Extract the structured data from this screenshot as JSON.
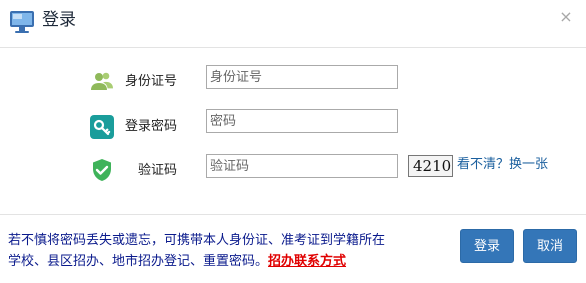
{
  "dialog": {
    "title": "登录",
    "close_glyph": "×",
    "icon": "monitor-icon"
  },
  "form": {
    "id_number": {
      "label": "身份证号",
      "placeholder": "身份证号",
      "value": "",
      "icon": "users-icon"
    },
    "password": {
      "label": "登录密码",
      "placeholder": "密码",
      "value": "",
      "icon": "key-icon"
    },
    "captcha": {
      "label": "验证码",
      "placeholder": "验证码",
      "value": "",
      "icon": "shield-check-icon",
      "image_text": "4210",
      "refresh_label": "看不清？换一张"
    }
  },
  "notice": {
    "line1": "若不慎将密码丢失或遗忘，可携带本人身份证、准考证到学籍所在",
    "line2": "学校、县区招办、地市招办登记、重置密码。",
    "link_label": "招办联系方式"
  },
  "buttons": {
    "login_label": "登录",
    "cancel_label": "取消"
  },
  "colors": {
    "primary": "#3476b8",
    "notice_text": "#0a1a8c",
    "link_red": "#e00000",
    "refresh_link": "#1a5f9e"
  }
}
